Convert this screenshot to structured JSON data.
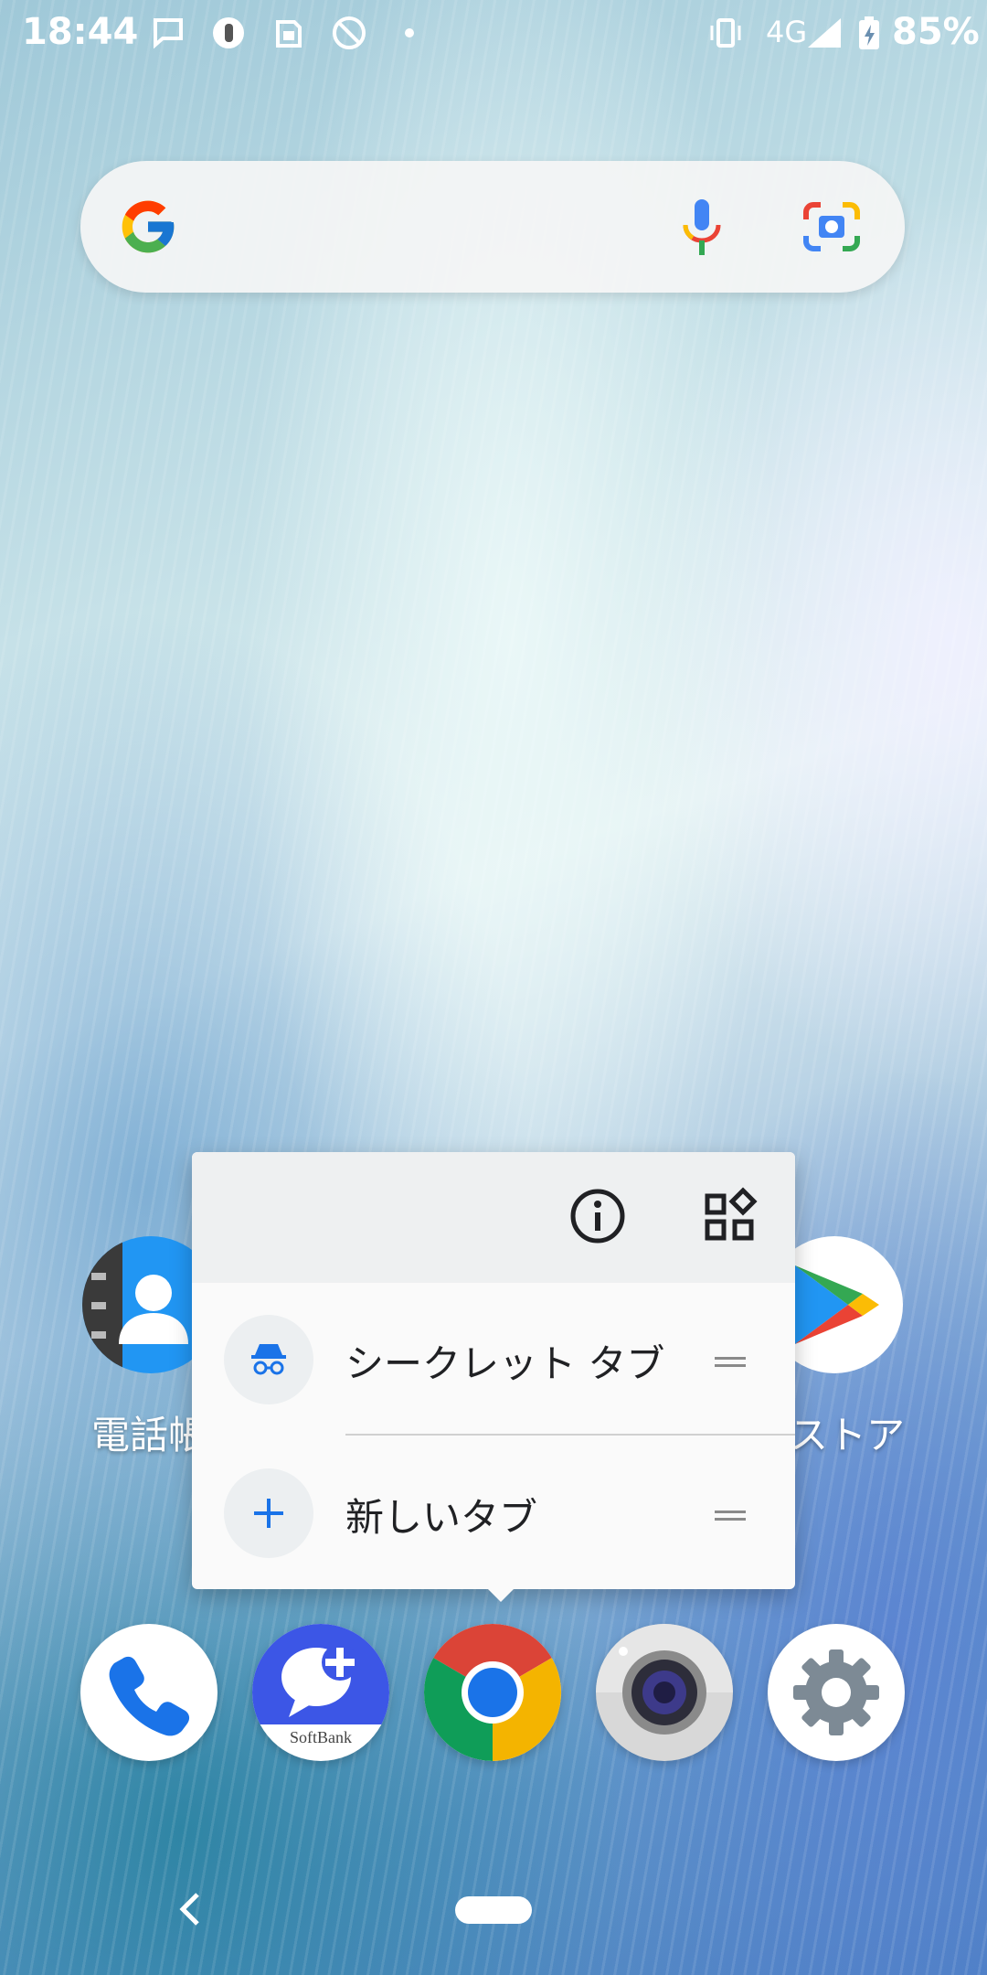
{
  "status_bar": {
    "time": "18:44",
    "network": "4G",
    "battery": "85%",
    "icons": [
      "message-icon",
      "app-notification-icon",
      "sim-card-icon",
      "no-touch-icon",
      "dot-icon",
      "vibrate-icon",
      "signal-icon",
      "battery-charging-icon"
    ]
  },
  "search_bar": {
    "icons": [
      "google-logo-icon",
      "microphone-icon",
      "google-lens-icon"
    ]
  },
  "home_row": {
    "left_app_label": "電話帳",
    "right_app_label": "ストア"
  },
  "popup": {
    "header_icons": [
      "app-info-icon",
      "widgets-icon"
    ],
    "items": [
      {
        "label": "シークレット タブ",
        "icon": "incognito-icon"
      },
      {
        "label": "新しいタブ",
        "icon": "plus-icon"
      }
    ]
  },
  "dock": {
    "apps": [
      "phone-app",
      "softbank-message-app",
      "chrome-app",
      "camera-app",
      "settings-app"
    ],
    "softbank_text": "SoftBank"
  },
  "colors": {
    "accent_blue": "#1a73e8",
    "popup_bg": "#fafafa",
    "popup_header_bg": "#eef0f1"
  }
}
